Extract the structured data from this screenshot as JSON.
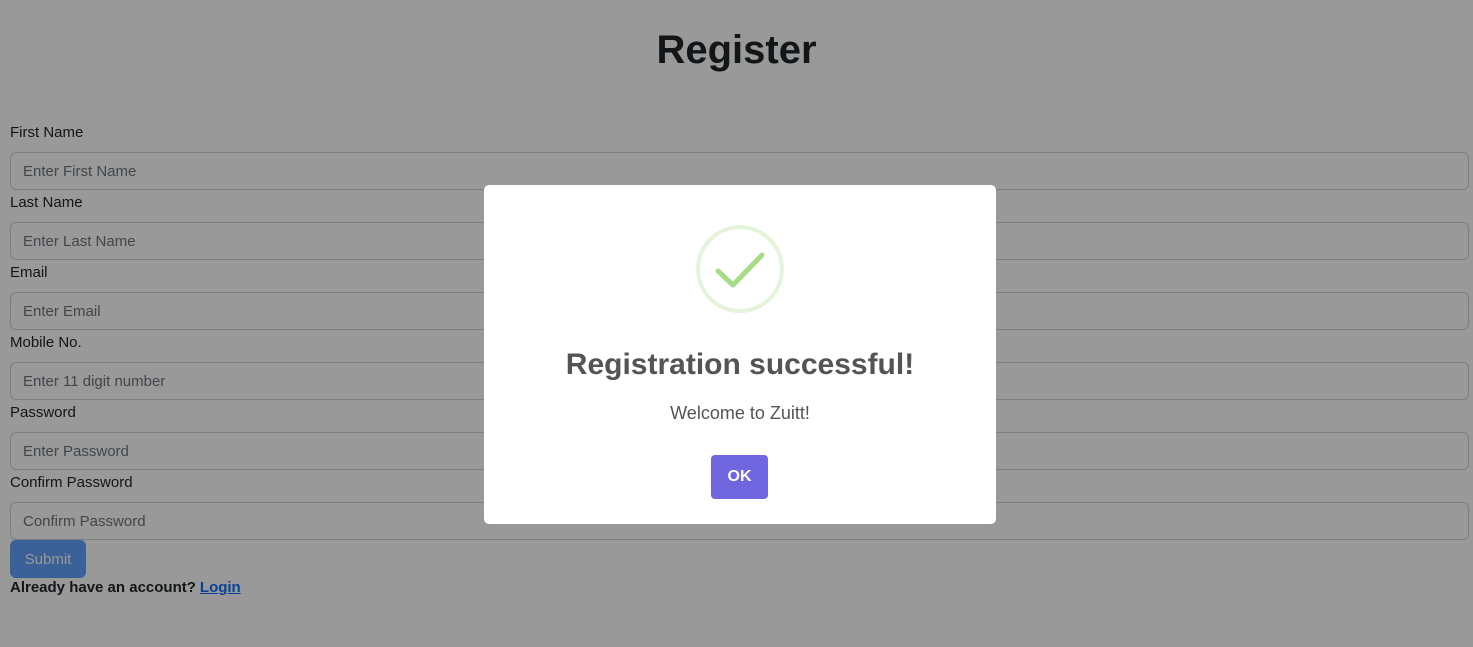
{
  "page": {
    "title": "Register"
  },
  "form": {
    "fields": [
      {
        "label": "First Name",
        "placeholder": "Enter First Name",
        "value": ""
      },
      {
        "label": "Last Name",
        "placeholder": "Enter Last Name",
        "value": ""
      },
      {
        "label": "Email",
        "placeholder": "Enter Email",
        "value": ""
      },
      {
        "label": "Mobile No.",
        "placeholder": "Enter 11 digit number",
        "value": ""
      },
      {
        "label": "Password",
        "placeholder": "Enter Password",
        "value": ""
      },
      {
        "label": "Confirm Password",
        "placeholder": "Confirm Password",
        "value": ""
      }
    ],
    "submit_label": "Submit",
    "account_prompt": "Already have an account?",
    "login_link": "Login"
  },
  "modal": {
    "icon": "success-check-icon",
    "title": "Registration successful!",
    "text": "Welcome to Zuitt!",
    "confirm_label": "OK"
  },
  "colors": {
    "primary": "#0d6efd",
    "modal_confirm": "#7066e0",
    "success_icon": "#a5dc86",
    "success_ring": "rgba(165,220,134,0.3)"
  }
}
